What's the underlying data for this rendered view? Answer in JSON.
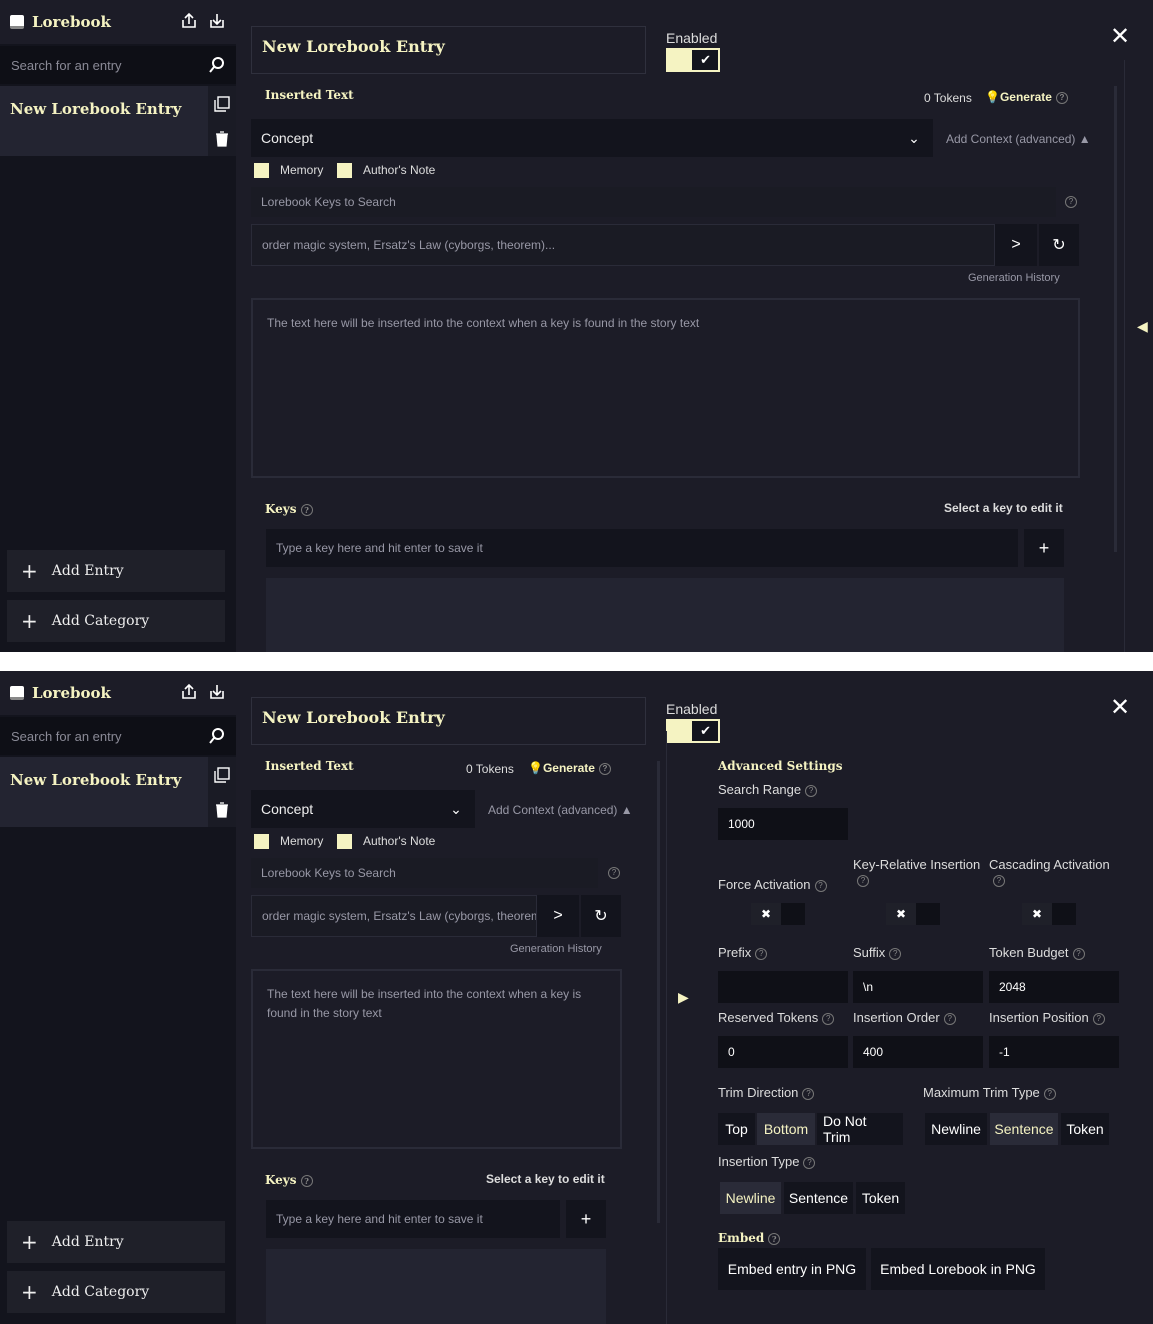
{
  "sidebar": {
    "title": "Lorebook",
    "search_placeholder": "Search for an entry",
    "entry_name": "New Lorebook Entry",
    "add_entry": "Add Entry",
    "add_category": "Add Category"
  },
  "editor": {
    "entry_title": "New Lorebook Entry",
    "enabled_label": "Enabled",
    "inserted_text": "Inserted Text",
    "tokens": "0 Tokens",
    "generate": "Generate",
    "concept": "Concept",
    "add_context": "Add Context (advanced)",
    "memory": "Memory",
    "authors_note": "Author's Note",
    "keys_to_search": "Lorebook Keys to Search",
    "keys_prompt": "order magic system, Ersatz's Law (cyborgs, theorem)...",
    "keys_prompt_short": "order magic system, Ersatz's Law (cyborgs, theorem",
    "generation_history": "Generation History",
    "textarea_placeholder": "The text here will be inserted into the context when a key is found in the story text",
    "keys_label": "Keys",
    "select_key": "Select a key to edit it",
    "key_placeholder": "Type a key here and hit enter to save it"
  },
  "advanced": {
    "title": "Advanced Settings",
    "search_range": "Search Range",
    "search_range_value": "1000",
    "force_activation": "Force Activation",
    "key_relative": "Key-Relative Insertion",
    "cascading": "Cascading Activation",
    "prefix": "Prefix",
    "prefix_value": "",
    "suffix": "Suffix",
    "suffix_value": "\\n",
    "token_budget": "Token Budget",
    "token_budget_value": "2048",
    "reserved_tokens": "Reserved Tokens",
    "reserved_tokens_value": "0",
    "insertion_order": "Insertion Order",
    "insertion_order_value": "400",
    "insertion_position": "Insertion Position",
    "insertion_position_value": "-1",
    "trim_direction": "Trim Direction",
    "trim_options": [
      "Top",
      "Bottom",
      "Do Not Trim"
    ],
    "trim_selected": "Bottom",
    "max_trim": "Maximum Trim Type",
    "max_trim_options": [
      "Newline",
      "Sentence",
      "Token"
    ],
    "max_trim_selected": "Sentence",
    "insertion_type": "Insertion Type",
    "insertion_type_options": [
      "Newline",
      "Sentence",
      "Token"
    ],
    "insertion_type_selected": "Newline",
    "embed": "Embed",
    "embed_entry": "Embed entry in PNG",
    "embed_lorebook": "Embed Lorebook in PNG"
  },
  "colors": {
    "accent": "#f5f3c2",
    "background": "#1c1c27",
    "sidebar": "#13141d"
  }
}
